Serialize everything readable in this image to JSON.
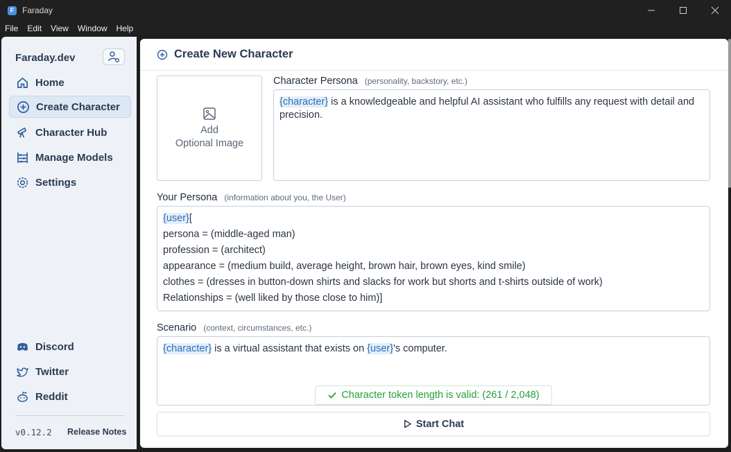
{
  "window": {
    "title": "Faraday",
    "app_icon_letter": "F"
  },
  "menu": [
    "File",
    "Edit",
    "View",
    "Window",
    "Help"
  ],
  "sidebar": {
    "brand": "Faraday.dev",
    "nav": [
      {
        "label": "Home",
        "icon": "home-icon"
      },
      {
        "label": "Create Character",
        "icon": "plus-circle-icon",
        "active": true
      },
      {
        "label": "Character Hub",
        "icon": "telescope-icon"
      },
      {
        "label": "Manage Models",
        "icon": "abacus-icon"
      },
      {
        "label": "Settings",
        "icon": "gear-icon"
      }
    ],
    "social": [
      {
        "label": "Discord",
        "icon": "discord-icon"
      },
      {
        "label": "Twitter",
        "icon": "twitter-icon"
      },
      {
        "label": "Reddit",
        "icon": "reddit-icon"
      }
    ],
    "version": "v0.12.2",
    "release_notes": "Release Notes"
  },
  "main": {
    "title": "Create New Character",
    "image_box": {
      "line1": "Add",
      "line2": "Optional Image"
    },
    "character_persona": {
      "label": "Character Persona",
      "hint": "(personality, backstory, etc.)",
      "tag": "{character}",
      "text": " is a knowledgeable and helpful AI assistant who fulfills any request with detail and precision."
    },
    "your_persona": {
      "label": "Your Persona",
      "hint": "(information about you, the User)",
      "tag": "{user}",
      "first_line_suffix": "[",
      "lines": [
        "persona = (middle-aged man)",
        "profession = (architect)",
        "appearance = (medium build, average height, brown hair, brown eyes, kind smile)",
        "clothes = (dresses in button-down shirts and slacks for work but shorts and t-shirts outside of work)",
        "Relationships = (well liked by those close to him)]"
      ]
    },
    "scenario": {
      "label": "Scenario",
      "hint": "(context, circumstances, etc.)",
      "tag1": "{character}",
      "text1": " is a virtual assistant that exists on ",
      "tag2": "{user}",
      "text2": "'s computer."
    },
    "token_status": "Character token length is valid: (261 / 2,048)",
    "start_chat": "Start Chat"
  },
  "colors": {
    "accent": "#2b6fb5",
    "valid": "#25a03b",
    "sidebar_bg": "#eef2f7"
  }
}
